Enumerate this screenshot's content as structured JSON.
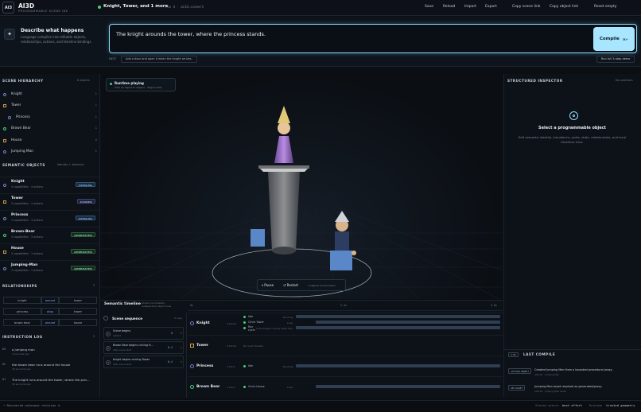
{
  "app": {
    "logo_text": "AI3",
    "title": "AI3D",
    "subtitle": "PROGRAMMABLE SCENE IDE",
    "scene_title": "Knight, Tower, and 1 more",
    "scene_rev": "rev 4 · ai3d.scene/1"
  },
  "toolbar": {
    "save": "Save",
    "reload": "Reload",
    "import": "Import",
    "export": "Export",
    "copy_scene_link": "Copy scene link",
    "copy_object_link": "Copy object link",
    "reset_empty": "Reset empty"
  },
  "describe": {
    "title": "Describe what happens",
    "description": "Language compiles into editable objects, relationships, actions, and timeline bindings.",
    "prompt_text": "The knight arounds the tower, where the princess stands.",
    "compile_label": "Compile",
    "compile_shortcut": "⌘↵",
    "next_label": "NEXT",
    "next_suggestion": "Add a door and open it when the knight arrives.",
    "demo_label": "Run full 5-step demo"
  },
  "hierarchy": {
    "title": "SCENE HIERARCHY",
    "meta": "6 objects",
    "items": [
      {
        "label": "Knight",
        "count": "1",
        "shape": "dot",
        "indent": 0
      },
      {
        "label": "Tower",
        "count": "1",
        "shape": "sq",
        "indent": 0
      },
      {
        "label": "Princess",
        "count": "1",
        "shape": "dot",
        "indent": 1
      },
      {
        "label": "Brown Bear",
        "count": "1",
        "shape": "dot",
        "indent": 0
      },
      {
        "label": "House",
        "count": "0",
        "shape": "sq",
        "indent": 0
      },
      {
        "label": "Jumping Man",
        "count": "1",
        "shape": "dot",
        "indent": 0
      }
    ]
  },
  "semantic": {
    "title": "SEMANTIC OBJECTS",
    "meta": "Identity + behavior",
    "items": [
      {
        "name": "Knight",
        "sub": "4 capabilities · 4 actions",
        "badge": "CATALOG",
        "kind": "catalog",
        "shape": "dot"
      },
      {
        "name": "Tower",
        "sub": "3 capabilities · 1 actions",
        "badge": "STORED",
        "kind": "stored",
        "shape": "sq"
      },
      {
        "name": "Princess",
        "sub": "3 capabilities · 3 actions",
        "badge": "CATALOG",
        "kind": "catalog",
        "shape": "dot"
      },
      {
        "name": "Brown-Bear",
        "sub": "3 capabilities · 3 actions",
        "badge": "GENERATED",
        "kind": "generated",
        "shape": "dot"
      },
      {
        "name": "House",
        "sub": "3 capabilities · 1 actions",
        "badge": "GENERATED",
        "kind": "generated",
        "shape": "sq"
      },
      {
        "name": "Jumping-Man",
        "sub": "3 capabilities · 3 actions",
        "badge": "GENERATED",
        "kind": "generated",
        "shape": "dot"
      }
    ]
  },
  "relationships": {
    "title": "RELATIONSHIPS",
    "count": "3",
    "items": [
      {
        "a": "knight",
        "verb": "around",
        "b": "tower"
      },
      {
        "a": "princess",
        "verb": "atop",
        "b": "tower"
      },
      {
        "a": "brown bear",
        "verb": "around",
        "b": "house"
      }
    ]
  },
  "instruction_log": {
    "title": "INSTRUCTION LOG",
    "count": "3",
    "items": [
      {
        "id": "#3",
        "text": "a jumping man",
        "time": "2 seconds ago"
      },
      {
        "id": "#2",
        "text": "the brown bear runs around the house",
        "time": "18 seconds ago"
      },
      {
        "id": "#1",
        "text": "The knight runs around the tower, where the prin...",
        "time": "36 seconds ago"
      }
    ]
  },
  "viewport": {
    "runtime_title": "Runtime playing",
    "runtime_sub": "Click an object to inspect · drag to orbit",
    "pause_label": "Pause",
    "restart_label": "Restart",
    "play_meta": "4 objects 5 local tracks"
  },
  "timeline": {
    "title": "Semantic timeline",
    "subtitle": "Global coordination · Independent object lines",
    "ticks": [
      "0s",
      "2.4s",
      "4.8s"
    ],
    "sequence_title": "Scene sequence",
    "sequence_meta": "3 cues",
    "sequence": [
      {
        "num": "1",
        "title": "Scene begins",
        "sub": "default",
        "val": "0",
        "v2": "0"
      },
      {
        "num": "2",
        "title": "Brown Bear begins circling H...",
        "sub": "after scene start",
        "val": "0.4",
        "v2": "2"
      },
      {
        "num": "3",
        "title": "Knight begins circling Tower",
        "sub": "after scene start",
        "val": "0.4",
        "v2": "2"
      }
    ],
    "rows": [
      {
        "name": "Knight",
        "count": "3 tracks",
        "shape": "dot",
        "tracks": [
          {
            "label": "Idle",
            "state": "Running"
          },
          {
            "label": "Circle Tower",
            "state": "Loop"
          },
          {
            "label": "Run cycle",
            "state": "4 the knight circling tower this"
          }
        ]
      },
      {
        "name": "Tower",
        "count": "0 tracks",
        "shape": "sq",
        "empty": "No local timeline"
      },
      {
        "name": "Princess",
        "count": "1 track",
        "shape": "dot",
        "tracks": [
          {
            "label": "Idle",
            "state": "Running"
          }
        ]
      },
      {
        "name": "Brown Bear",
        "count": "1 track",
        "shape": "dot",
        "tracks": [
          {
            "label": "Circle House",
            "state": "Loop"
          }
        ]
      }
    ]
  },
  "inspector": {
    "title": "STRUCTURED INSPECTOR",
    "meta": "No selection",
    "heading": "Select a programmable object",
    "desc": "Edit semantic identity, transforms, parts, state, relationships, and local timelines here.",
    "last_compile_badge": "3 OK",
    "last_compile_title": "LAST COMPILE",
    "activity": [
      {
        "tag": "AUTHOR OBJECT",
        "text": "Created Jumping Man from a bounded procedural proxy.",
        "time": "ai3d.kit · Jumping Man"
      },
      {
        "tag": "SET ASSET",
        "text": "Jumping Man asset resolved as generated/proxy.",
        "time": "ai3d.kit · Jumping Man asset"
      }
    ]
  },
  "statusbar": {
    "left": "• Recovered autosave revision 4.",
    "right_label1": "Stored search",
    "right_val1": "best effort",
    "right_label2": "Runtime",
    "right_val2": "trusted geometry"
  }
}
